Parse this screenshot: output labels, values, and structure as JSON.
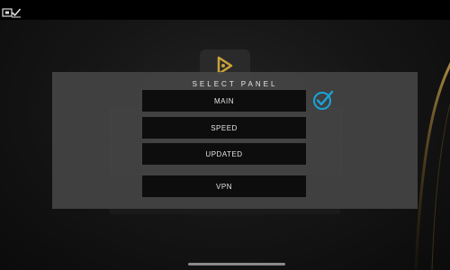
{
  "modal": {
    "title": "SELECT PANEL",
    "options": [
      {
        "label": "MAIN",
        "selected": true
      },
      {
        "label": "SPEED",
        "selected": false
      },
      {
        "label": "UPDATED",
        "selected": false
      },
      {
        "label": "VPN",
        "selected": false
      }
    ]
  },
  "icons": {
    "status_left": "screenshot-icon",
    "status_right": "checkmark-icon",
    "logo": "play-logo-icon",
    "selected": "check-circle-icon"
  },
  "colors": {
    "accent": "#1aa3d9",
    "logo_gold": "#c9a23a",
    "modal_bg": "#444444",
    "option_bg": "#0d0d0d"
  }
}
